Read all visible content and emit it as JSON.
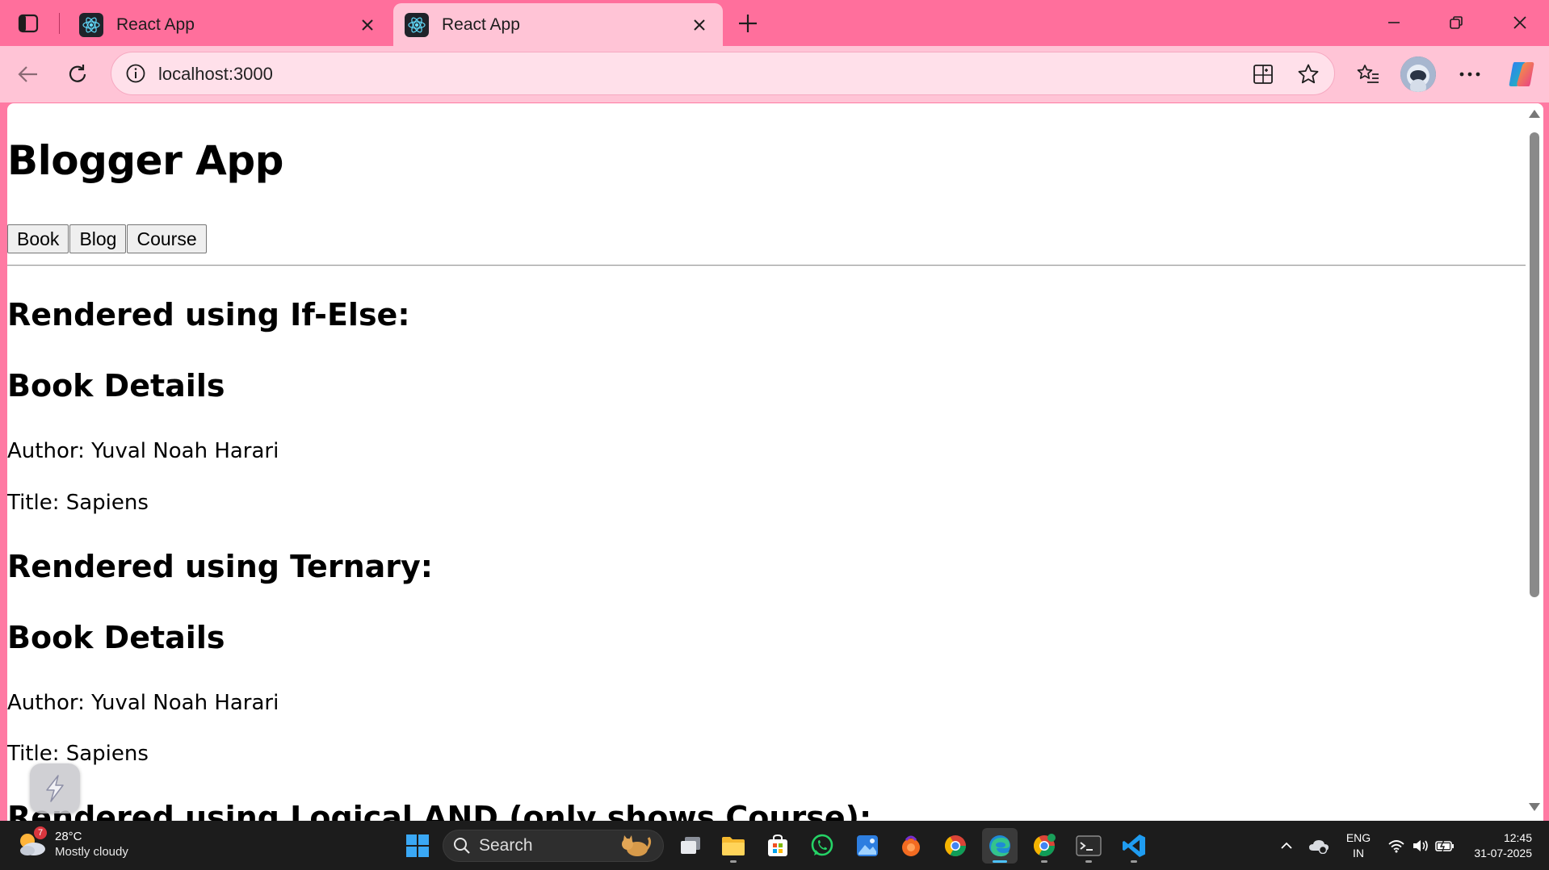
{
  "browser": {
    "tabs": [
      {
        "title": "React App",
        "active": false
      },
      {
        "title": "React App",
        "active": true
      }
    ],
    "address": "localhost:3000",
    "accent": "#ff6f9c",
    "toolbar_bg": "#ffc4d6"
  },
  "page": {
    "heading": "Blogger App",
    "buttons": [
      "Book",
      "Blog",
      "Course"
    ],
    "sections": [
      {
        "heading": "Rendered using If-Else:",
        "subheading": "Book Details",
        "author": "Author: Yuval Noah Harari",
        "title": "Title: Sapiens"
      },
      {
        "heading": "Rendered using Ternary:",
        "subheading": "Book Details",
        "author": "Author: Yuval Noah Harari",
        "title": "Title: Sapiens"
      },
      {
        "heading": "Rendered using Logical AND (only shows Course):"
      }
    ]
  },
  "taskbar": {
    "weather": {
      "temp": "28°C",
      "condition": "Mostly cloudy",
      "badge": "7"
    },
    "search_label": "Search",
    "language": {
      "line1": "ENG",
      "line2": "IN"
    },
    "time": "12:45",
    "date": "31-07-2025",
    "apps": [
      "windows-start",
      "search",
      "task-view",
      "file-explorer",
      "microsoft-store",
      "whatsapp",
      "photos",
      "app-orange",
      "chrome",
      "edge",
      "chrome-profile",
      "terminal",
      "vscode"
    ]
  }
}
